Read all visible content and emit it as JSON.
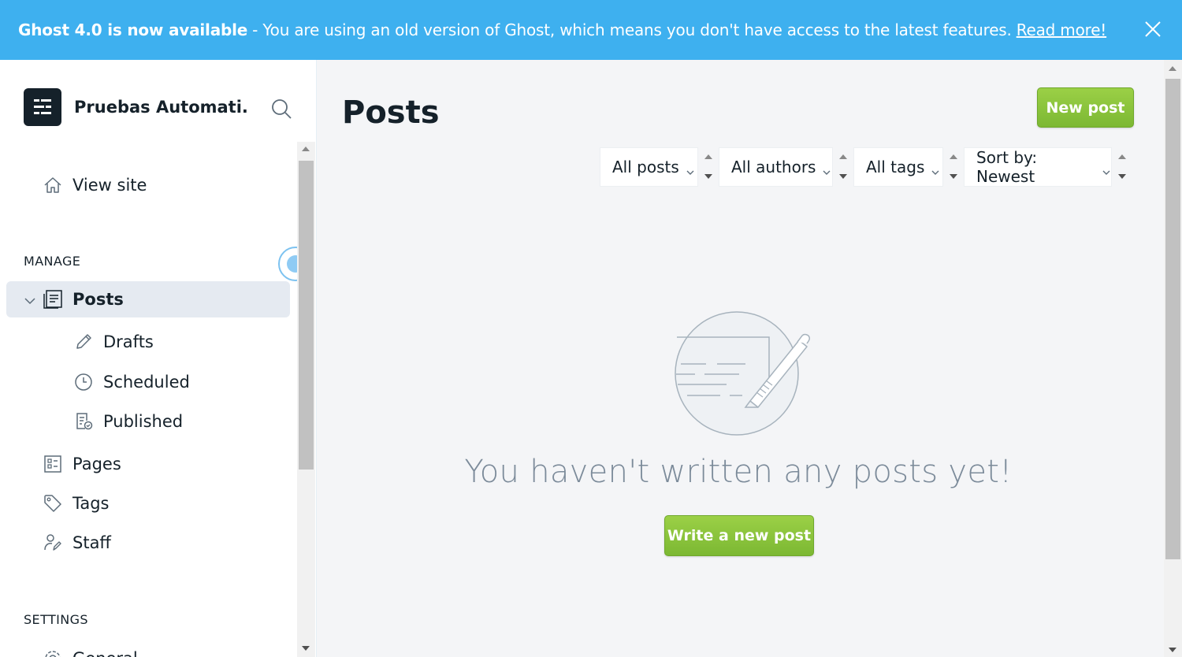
{
  "banner": {
    "headline": "Ghost 4.0 is now available",
    "message": "- You are using an old version of Ghost, which means you don't have access to the latest features.",
    "link": "Read more!",
    "bg_color": "#3eb0ef"
  },
  "sidebar": {
    "site_name": "Pruebas Automati...",
    "view_site": "View site",
    "manage_title": "MANAGE",
    "settings_title": "SETTINGS",
    "items": {
      "posts": "Posts",
      "drafts": "Drafts",
      "scheduled": "Scheduled",
      "published": "Published",
      "pages": "Pages",
      "tags": "Tags",
      "staff": "Staff",
      "general": "General"
    }
  },
  "main": {
    "title": "Posts",
    "new_post": "New post",
    "filters": {
      "type": "All posts",
      "author": "All authors",
      "tag": "All tags",
      "sort": "Sort by: Newest"
    },
    "empty_message": "You haven't written any posts yet!",
    "write_button": "Write a new post",
    "accent_color": "#85c43c"
  }
}
